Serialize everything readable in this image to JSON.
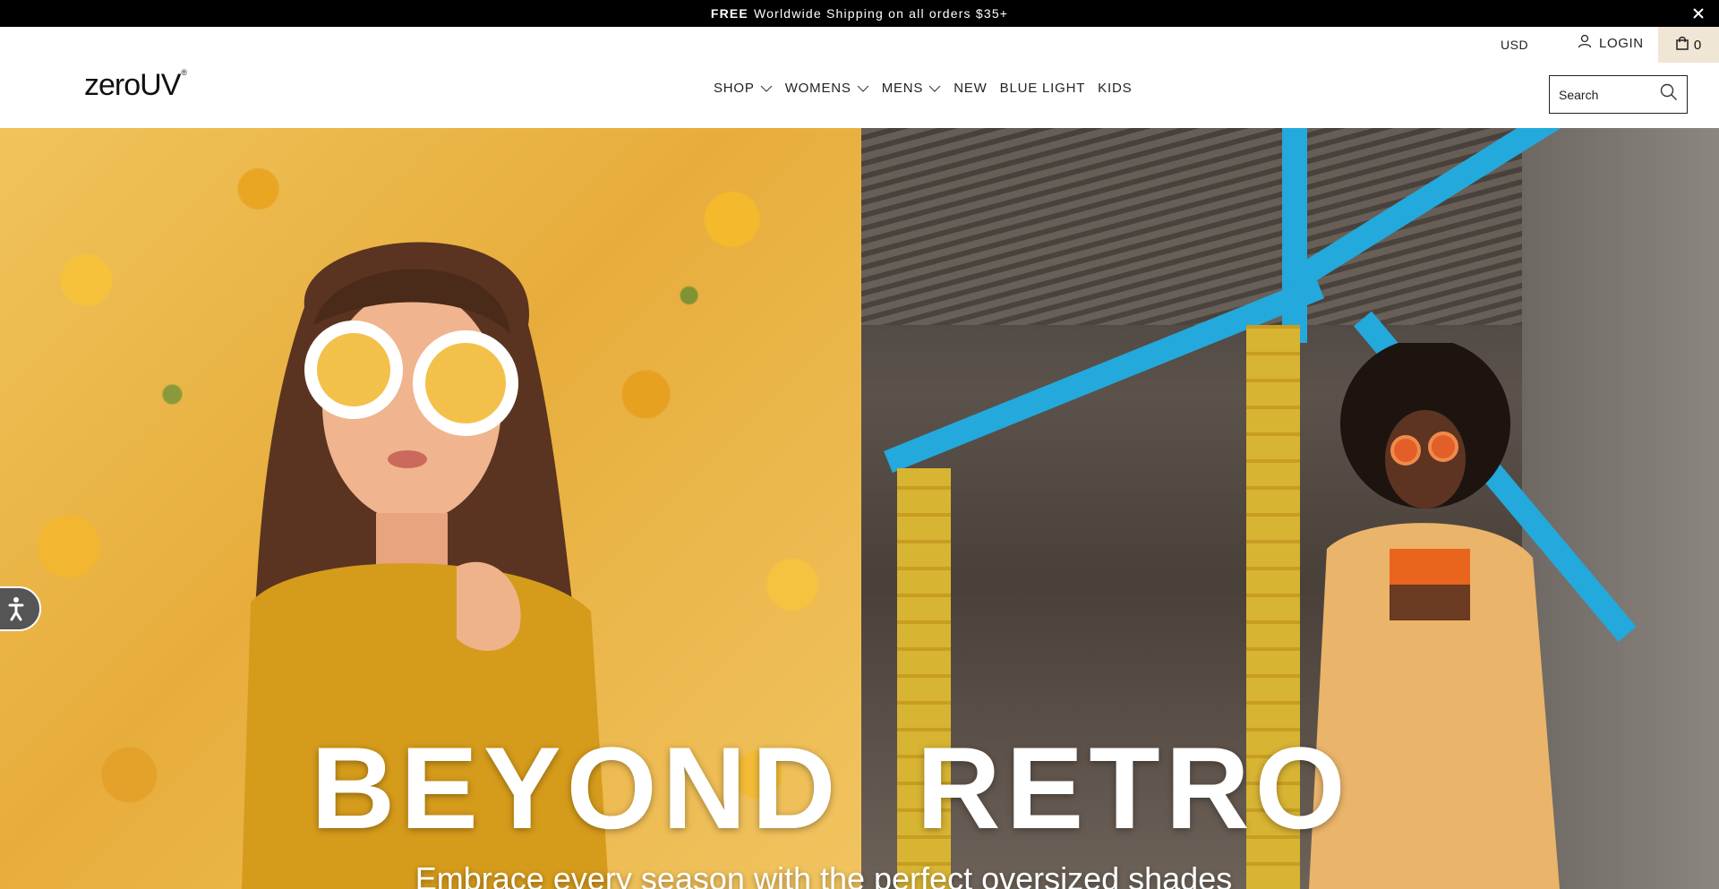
{
  "announcement": {
    "bold": "FREE",
    "text": "Worldwide Shipping on all orders $35+"
  },
  "header": {
    "currency": "USD",
    "login_label": "LOGIN",
    "cart_count": "0",
    "logo_text": "zeroUV",
    "logo_mark": "®",
    "search_placeholder": "Search"
  },
  "nav": {
    "items": [
      {
        "label": "SHOP",
        "dropdown": true
      },
      {
        "label": "WOMENS",
        "dropdown": true
      },
      {
        "label": "MENS",
        "dropdown": true
      },
      {
        "label": "NEW",
        "dropdown": false
      },
      {
        "label": "BLUE LIGHT",
        "dropdown": false
      },
      {
        "label": "KIDS",
        "dropdown": false
      }
    ]
  },
  "hero": {
    "title": "BEYOND  RETRO",
    "subtitle": "Embrace every season with the perfect oversized shades"
  },
  "icons": {
    "close": "close-icon",
    "user": "user-icon",
    "bag": "shopping-bag-icon",
    "search": "search-icon",
    "chevron": "chevron-down-icon",
    "accessibility": "accessibility-icon"
  },
  "colors": {
    "announcement_bg": "#000000",
    "cart_bg": "#efe6d6",
    "beam_blue": "#23a9dc"
  }
}
